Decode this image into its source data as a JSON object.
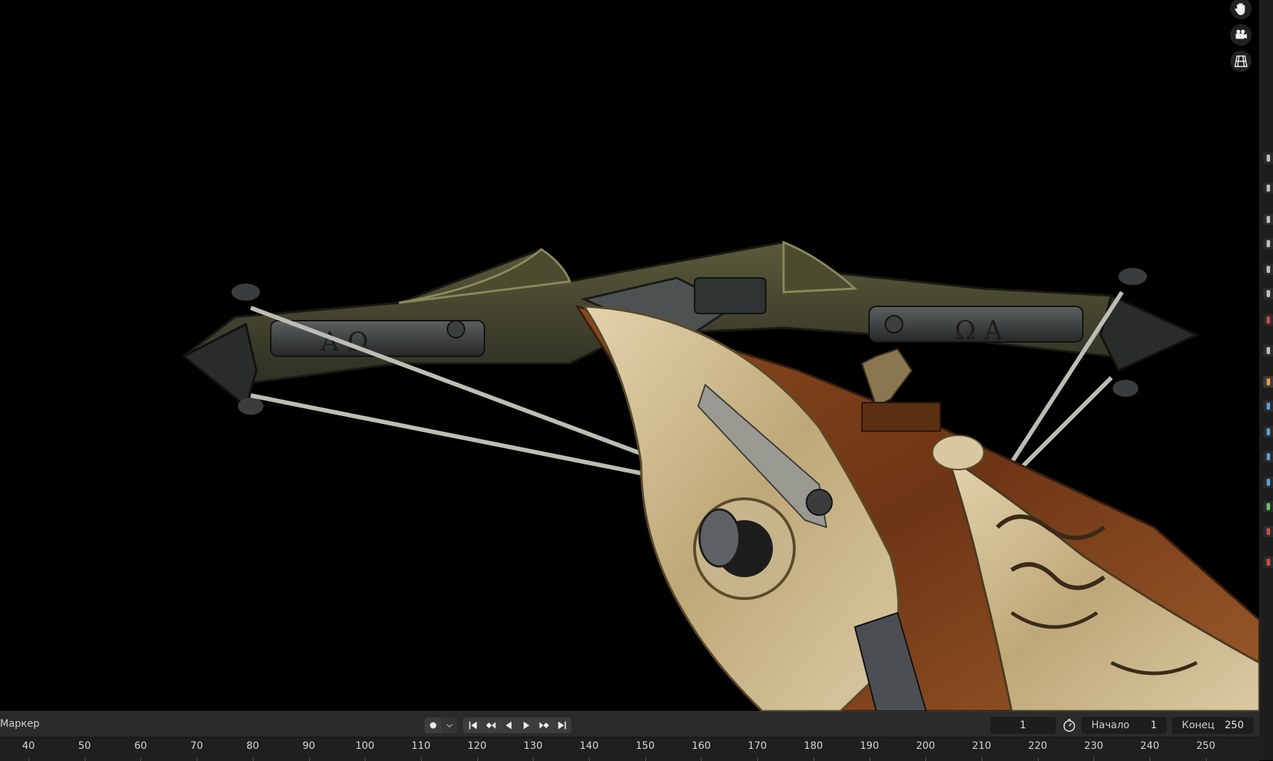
{
  "viewport": {
    "background": "#000000",
    "nav_gizmo": [
      {
        "name": "pan-hand-icon"
      },
      {
        "name": "camera-view-icon"
      },
      {
        "name": "ortho-grid-icon"
      }
    ],
    "object": "crossbow-model"
  },
  "timeline": {
    "marker_label": "Маркер",
    "current_frame": "1",
    "start_label": "Начало",
    "start_value": "1",
    "end_label": "Конец",
    "end_value": "250",
    "ruler_ticks": [
      "40",
      "50",
      "60",
      "70",
      "80",
      "90",
      "100",
      "110",
      "120",
      "130",
      "140",
      "150",
      "160",
      "170",
      "180",
      "190",
      "200",
      "210",
      "220",
      "230",
      "240",
      "250"
    ],
    "playback_buttons": [
      "jump-to-start-icon",
      "jump-to-keyframe-prev-icon",
      "play-reverse-icon",
      "play-icon",
      "jump-to-keyframe-next-icon",
      "jump-to-end-icon"
    ]
  },
  "colors": {
    "ui_panel": "#2b2b2b",
    "ui_field": "#1d1d1d",
    "text": "#d8d8d8",
    "wood": "#7a3f1a",
    "bone": "#c8b48a",
    "iron": "#2f3130"
  }
}
